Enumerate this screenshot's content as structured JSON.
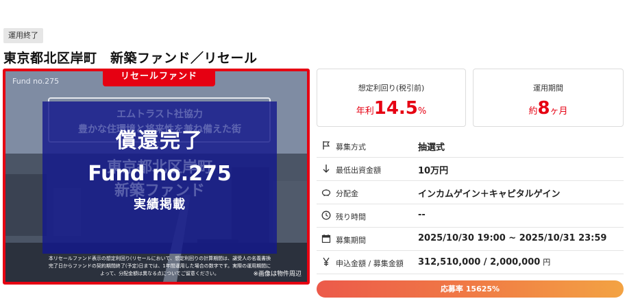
{
  "status_badge": "運用終了",
  "title": "東京都北区岸町　新築ファンド／リセール",
  "image": {
    "fund_no_small": "Fund no.275",
    "resale_tab": "リセールファンド",
    "ghost_line1": "エムトラスト社協力",
    "ghost_line2": "豊かな住環境と将来性を兼ね備えた街",
    "ghost_line3": "東京都北区岸町",
    "ghost_line4": "新築ファンド",
    "overlay_line1": "償還完了",
    "overlay_line2": "Fund no.275",
    "overlay_line3": "実績掲載",
    "disclaimer": "本リセールファンド表示の想定利回り(リセールにおいて、想定利回りの計算期間は、譲受人の名義書換完了日からファンドの契約期間終了(予定)日までは、1年間運用した場合の数字です。実際の運用期間によって、分配金額は異なる点についてご留意ください。",
    "note": "※画像は物件周辺"
  },
  "yield_card": {
    "label": "想定利回り(税引前)",
    "prefix": "年利",
    "number": "14.5",
    "suffix": "%"
  },
  "period_card": {
    "label": "運用期間",
    "prefix": "約",
    "number": "8",
    "suffix": "ヶ月"
  },
  "info_rows": [
    {
      "icon": "flag-icon",
      "label": "募集方式",
      "value": "抽選式",
      "unit": ""
    },
    {
      "icon": "arrow-down-icon",
      "label": "最低出資金額",
      "value": "10万円",
      "unit": ""
    },
    {
      "icon": "piggy-bank-icon",
      "label": "分配金",
      "value": "インカムゲイン＋キャピタルゲイン",
      "unit": ""
    },
    {
      "icon": "clock-icon",
      "label": "残り時間",
      "value": "--",
      "unit": ""
    },
    {
      "icon": "calendar-icon",
      "label": "募集期間",
      "value": "2025/10/30 19:00 ~ 2025/10/31 23:59",
      "unit": ""
    },
    {
      "icon": "yen-icon",
      "label": "申込金額 / 募集金額",
      "value": "312,510,000 / 2,000,000",
      "unit": "円"
    }
  ],
  "progress": {
    "label": "応募率 15625%",
    "ratio_percent": 15625
  },
  "colors": {
    "accent": "#e60012",
    "overlay": "#14188c"
  }
}
